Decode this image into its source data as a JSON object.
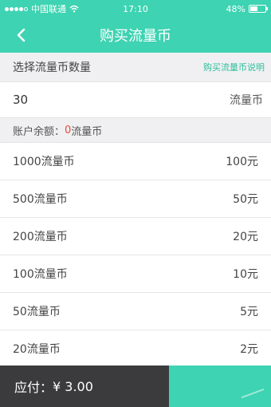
{
  "status_bar": {
    "carrier": "中国联通",
    "time": "17:10",
    "battery": "48%",
    "battery_level": 0.48
  },
  "navbar": {
    "title": "购买流量币"
  },
  "select_section": {
    "label": "选择流量币数量",
    "help_link": "购买流量币说明"
  },
  "amount_input": {
    "value": "30",
    "unit": "流量币"
  },
  "balance": {
    "prefix": "账户余额：",
    "amount": "0",
    "suffix": "流量币"
  },
  "packages": [
    {
      "name": "1000流量币",
      "price": "100元"
    },
    {
      "name": "500流量币",
      "price": "50元"
    },
    {
      "name": "200流量币",
      "price": "20元"
    },
    {
      "name": "100流量币",
      "price": "10元"
    },
    {
      "name": "50流量币",
      "price": "5元"
    },
    {
      "name": "20流量币",
      "price": "2元"
    }
  ],
  "footer": {
    "pay_label": "应付：",
    "pay_amount": "¥ 3.00"
  },
  "colors": {
    "accent": "#3ed3b2",
    "link": "#2ebf9e",
    "highlight": "#ec4a3c",
    "footer_dark": "#3b3b3d"
  },
  "icons": {
    "back": "chevron-left-icon",
    "wifi": "wifi-icon",
    "signal": "signal-icon",
    "battery": "battery-icon"
  }
}
